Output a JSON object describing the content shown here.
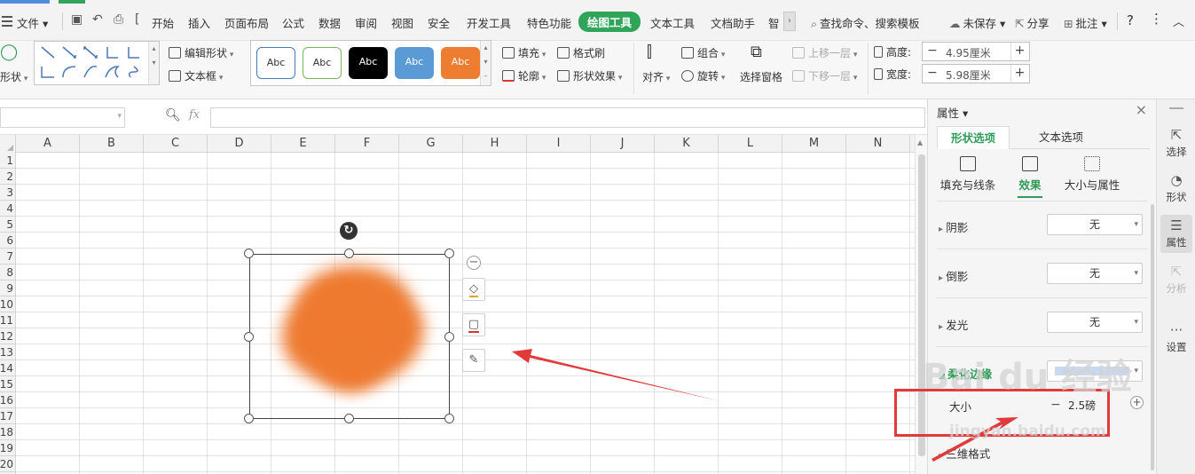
{
  "menubar": {
    "file": "文件",
    "tabs": [
      "开始",
      "插入",
      "页面布局",
      "公式",
      "数据",
      "审阅",
      "视图",
      "安全",
      "开发工具",
      "特色功能",
      "绘图工具",
      "文本工具",
      "文档助手",
      "智"
    ],
    "search": "查找命令、搜索模板",
    "unsaved": "未保存",
    "share": "分享",
    "comment": "批注",
    "help": "?"
  },
  "ribbon": {
    "shape_label": "形状",
    "edit_shape": "编辑形状",
    "text_box": "文本框",
    "style_sample": "Abc",
    "fill": "填充",
    "format_painter": "格式刷",
    "outline": "轮廓",
    "shape_effect": "形状效果",
    "align": "对齐",
    "group": "组合",
    "rotate": "旋转",
    "selection_pane": "选择窗格",
    "bring_forward": "上移一层",
    "send_backward": "下移一层",
    "height_label": "高度:",
    "height_value": "4.95厘米",
    "width_label": "宽度:",
    "width_value": "5.98厘米"
  },
  "formula": {
    "fx": "fx"
  },
  "grid": {
    "columns": [
      "A",
      "B",
      "C",
      "D",
      "E",
      "F",
      "G",
      "H",
      "I",
      "J",
      "K",
      "L",
      "M",
      "N"
    ],
    "rows": [
      "1",
      "2",
      "3",
      "4",
      "5",
      "6",
      "7",
      "8",
      "9",
      "10",
      "11",
      "12",
      "13",
      "14",
      "15",
      "16",
      "17",
      "18",
      "19",
      "20"
    ]
  },
  "shape": {
    "fill_color": "#ee7a30"
  },
  "panel": {
    "title": "属性",
    "tabs": [
      "形状选项",
      "文本选项"
    ],
    "subtabs": [
      "填充与线条",
      "效果",
      "大小与属性"
    ],
    "rows": [
      {
        "label": "阴影",
        "value": "无"
      },
      {
        "label": "倒影",
        "value": "无"
      },
      {
        "label": "发光",
        "value": "无"
      }
    ],
    "soft_edge_label": "柔化边缘",
    "size_label": "大小",
    "size_value": "2.5磅",
    "three_d": "三维格式"
  },
  "sidebar": {
    "items": [
      "选择",
      "形状",
      "属性",
      "分析",
      "设置"
    ]
  },
  "watermark": {
    "logo": "Bai du 经验",
    "url": "jingyan.baidu.com"
  },
  "colors": {
    "accent_green": "#2fa55a",
    "annotation_red": "#e23a3a"
  }
}
